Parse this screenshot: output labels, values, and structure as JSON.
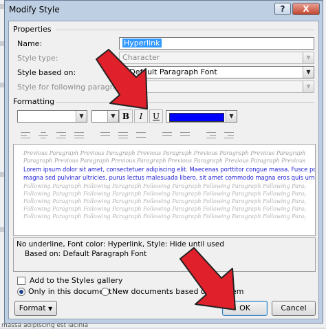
{
  "dialog": {
    "title": "Modify Style",
    "help_label": "?",
    "close_label": "X"
  },
  "properties": {
    "section_label": "Properties",
    "name_label": "Name:",
    "name_value": "Hyperlink",
    "style_type_label": "Style type:",
    "style_type_value": "Character",
    "style_based_on_label": "Style based on:",
    "style_based_on_value": "a Default Paragraph Font",
    "following_label": "Style for following paragraph:",
    "following_value": ""
  },
  "formatting": {
    "section_label": "Formatting",
    "font_value": "",
    "size_value": "",
    "bold_label": "B",
    "italic_label": "I",
    "underline_label": "U",
    "font_color": "#0000ff"
  },
  "preview": {
    "previous_lines": [
      "Previous Paragraph Previous Paragraph Previous Paragraph Previous Paragraph Previous Paragraph Previous",
      "Paragraph Previous Paragraph Previous Paragraph Previous Paragraph Previous Paragraph Previous Paragraph"
    ],
    "sample_lines": [
      "Lorem ipsum dolor sit amet, consectetuer adipiscing elit. Maecenas porttitor congue massa. Fusce posuere,",
      "magna sed pulvinar ultricies, purus lectus malesuada libero, sit amet commodo magna eros quis urna. Nu"
    ],
    "following_lines": [
      "Following Paragraph Following Paragraph Following Paragraph Following Paragraph Following Paragraph",
      "Following Paragraph Following Paragraph Following Paragraph Following Paragraph Following Paragraph",
      "Following Paragraph Following Paragraph Following Paragraph Following Paragraph Following Paragraph",
      "Following Paragraph Following Paragraph Following Paragraph Following Paragraph Following Paragraph",
      "Following Paragraph Following Paragraph Following Paragraph Following Paragraph Following Paragraph"
    ]
  },
  "description": {
    "line1": "No underline, Font color: Hyperlink, Style: Hide until used",
    "line2": "Based on: Default Paragraph Font"
  },
  "options": {
    "add_to_gallery": "Add to the Styles gallery",
    "only_this_doc": "Only in this document",
    "new_docs": "New documents based on this tem"
  },
  "buttons": {
    "format": "Format",
    "ok": "OK",
    "cancel": "Cancel"
  },
  "background": {
    "bottom_text": "massa adipiscing est lacinia"
  },
  "colors": {
    "annotation_arrow": "#e0202a",
    "title_bar": "#bfcfe3",
    "font_color_swatch": "#0000ff"
  }
}
